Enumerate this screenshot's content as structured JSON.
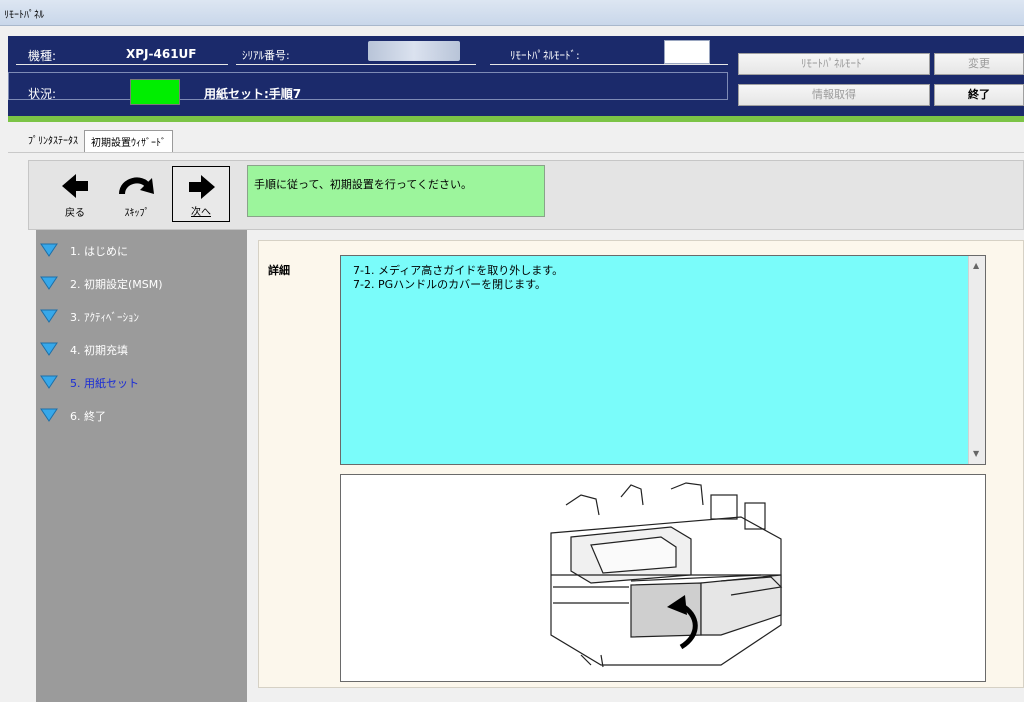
{
  "window": {
    "title": "ﾘﾓｰﾄﾊﾟﾈﾙ"
  },
  "header": {
    "model_label": "機種:",
    "model_value": "XPJ-461UF",
    "serial_label": "ｼﾘｱﾙ番号:",
    "remote_mode_label": "ﾘﾓｰﾄﾊﾟﾈﾙﾓｰﾄﾞ:",
    "status_label": "状況:",
    "status_text": "用紙セット:手順7",
    "status_led_color": "#00ee00"
  },
  "buttons": {
    "remote_panel_mode": "ﾘﾓｰﾄﾊﾟﾈﾙﾓｰﾄﾞ",
    "change": "変更",
    "get_info": "情報取得",
    "exit": "終了"
  },
  "tabs": [
    {
      "label": "ﾌﾟﾘﾝﾀｽﾃｰﾀｽ",
      "active": false
    },
    {
      "label": "初期設置ｳｨｻﾞｰﾄﾞ",
      "active": true
    }
  ],
  "toolbar": {
    "back_label": "戻る",
    "skip_label": "ｽｷｯﾌﾟ",
    "next_label": "次へ"
  },
  "message": "手順に従って、初期設置を行ってください。",
  "steps": [
    {
      "label": "1. はじめに"
    },
    {
      "label": "2. 初期設定(MSM)"
    },
    {
      "label": "3. ｱｸﾃｨﾍﾞｰｼｮﾝ"
    },
    {
      "label": "4. 初期充填"
    },
    {
      "label": "5. 用紙セット",
      "current": true
    },
    {
      "label": "6. 終了"
    }
  ],
  "detail": {
    "label": "詳細",
    "lines": [
      "7-1. メディア高さガイドを取り外します。",
      "7-2. PGハンドルのカバーを閉じます。"
    ]
  },
  "colors": {
    "header_bg": "#1b2a6b",
    "accent_bar": "#7cc446",
    "message_bg": "#9cf59c",
    "detail_bg": "#7afcfa",
    "steps_bg": "#9b9b9b",
    "current_step": "#1a2dd6"
  }
}
